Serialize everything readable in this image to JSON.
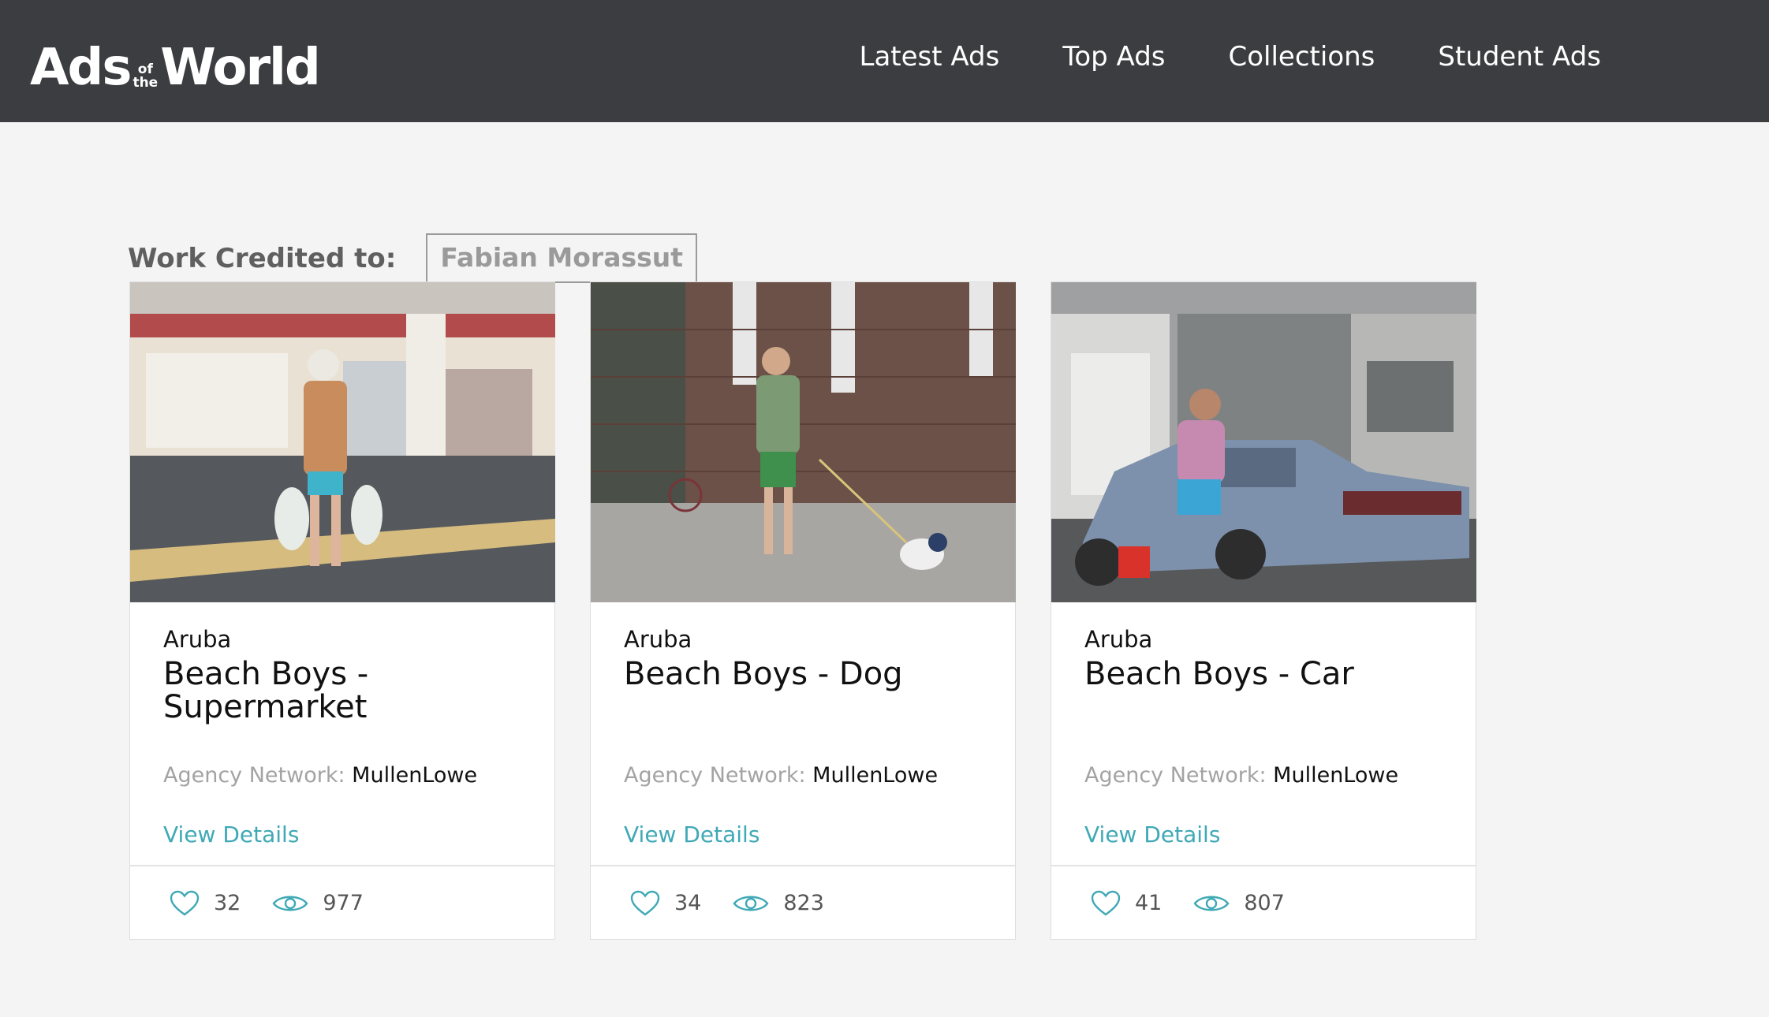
{
  "header": {
    "logo": {
      "part1": "Ads",
      "of": "of",
      "the": "the",
      "part2": "World"
    },
    "nav": [
      "Latest Ads",
      "Top Ads",
      "Collections",
      "Student Ads"
    ]
  },
  "credit": {
    "label": "Work Credited to:",
    "name": "Fabian Morassut"
  },
  "icons": {
    "like": "heart-icon",
    "views": "eye-icon",
    "accent": "#3fa9b5"
  },
  "cards": [
    {
      "brand": "Aruba",
      "title": "Beach Boys - Supermarket",
      "agency_label": "Agency Network:",
      "agency": "MullenLowe",
      "details": "View Details",
      "likes": "32",
      "views": "977"
    },
    {
      "brand": "Aruba",
      "title": "Beach Boys - Dog",
      "agency_label": "Agency Network:",
      "agency": "MullenLowe",
      "details": "View Details",
      "likes": "34",
      "views": "823"
    },
    {
      "brand": "Aruba",
      "title": "Beach Boys - Car",
      "agency_label": "Agency Network:",
      "agency": "MullenLowe",
      "details": "View Details",
      "likes": "41",
      "views": "807"
    }
  ]
}
